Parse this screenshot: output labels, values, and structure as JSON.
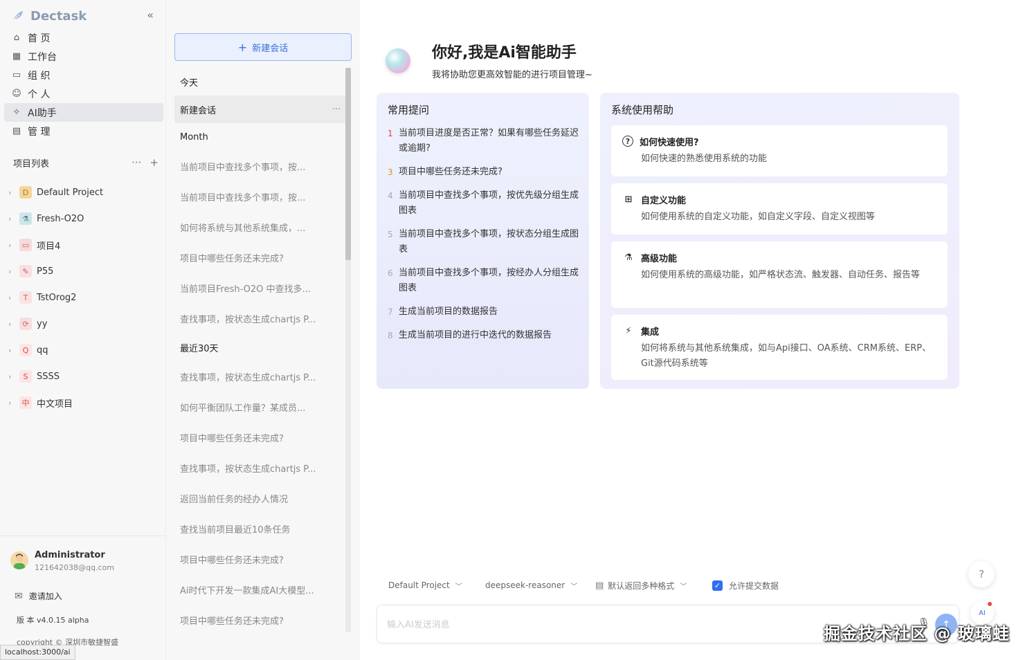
{
  "app": {
    "name": "Dectask"
  },
  "nav": [
    {
      "label": "首 页",
      "icon": "home-icon"
    },
    {
      "label": "工作台",
      "icon": "grid-icon"
    },
    {
      "label": "组 织",
      "icon": "folder-icon"
    },
    {
      "label": "个 人",
      "icon": "user-icon"
    },
    {
      "label": "AI助手",
      "icon": "ai-sparkle-icon",
      "active": true
    },
    {
      "label": "管 理",
      "icon": "manage-icon"
    }
  ],
  "projects_header": "项目列表",
  "projects": [
    {
      "label": "Default Project",
      "badge": "D",
      "color": "#f5d59a",
      "textColor": "#b07a2a"
    },
    {
      "label": "Fresh-O2O",
      "badge": "⚗",
      "color": "#cfe5e8",
      "textColor": "#4a7f88"
    },
    {
      "label": "项目4",
      "badge": "▭",
      "color": "#f7dada",
      "textColor": "#d05b5b"
    },
    {
      "label": "P55",
      "badge": "✎",
      "color": "#f8e0e0",
      "textColor": "#c56060"
    },
    {
      "label": "TstOrog2",
      "badge": "T",
      "color": "#fbe3e3",
      "textColor": "#d06060"
    },
    {
      "label": "yy",
      "badge": "⟳",
      "color": "#f6dede",
      "textColor": "#c86a6a"
    },
    {
      "label": "qq",
      "badge": "Q",
      "color": "#fde5e5",
      "textColor": "#d05050"
    },
    {
      "label": "SSSS",
      "badge": "S",
      "color": "#fde5e5",
      "textColor": "#d05050"
    },
    {
      "label": "中文项目",
      "badge": "中",
      "color": "#fde5e5",
      "textColor": "#d05050"
    }
  ],
  "user": {
    "name": "Administrator",
    "email": "121642038@qq.com",
    "invite": "邀请加入",
    "version": "版 本 v4.0.15 alpha",
    "copyright": "copyright © 深圳市敏捷智盛"
  },
  "status_url": "localhost:3000/ai",
  "conversations": {
    "new_chat": "新建会话",
    "groups": [
      {
        "title": "今天",
        "items": [
          {
            "label": "新建会话",
            "active": true
          }
        ]
      },
      {
        "title": "Month",
        "items": [
          {
            "label": "当前项目中查找多个事项，按..."
          },
          {
            "label": "当前项目中查找多个事项，按..."
          },
          {
            "label": "如何将系统与其他系统集成，..."
          },
          {
            "label": "项目中哪些任务还未完成?"
          },
          {
            "label": "当前项目Fresh-O2O 中查找多..."
          },
          {
            "label": "查找事项，按状态生成chartjs P..."
          }
        ]
      },
      {
        "title": "最近30天",
        "items": [
          {
            "label": "查找事项，按状态生成chartjs P..."
          },
          {
            "label": "如何平衡团队工作量？某成员..."
          },
          {
            "label": "项目中哪些任务还未完成?"
          },
          {
            "label": "查找事项，按状态生成chartjs P..."
          },
          {
            "label": "返回当前任务的经办人情况"
          },
          {
            "label": "查找当前项目最近10条任务"
          },
          {
            "label": "项目中哪些任务还未完成?"
          },
          {
            "label": "Ai时代下开发一款集成AI大模型..."
          },
          {
            "label": "项目中哪些任务还未完成?"
          }
        ]
      }
    ]
  },
  "hero": {
    "title": "你好,我是Ai智能助手",
    "subtitle": "我将协助您更高效智能的进行项目管理~"
  },
  "prompts": {
    "title": "常用提问",
    "items": [
      {
        "num": "1",
        "text": "当前项目进度是否正常？如果有哪些任务延迟或逾期?",
        "style": "r"
      },
      {
        "num": "3",
        "text": "项目中哪些任务还未完成?",
        "style": "o"
      },
      {
        "num": "4",
        "text": "当前项目中查找多个事项，按优先级分组生成图表",
        "style": ""
      },
      {
        "num": "5",
        "text": "当前项目中查找多个事项，按状态分组生成图表",
        "style": ""
      },
      {
        "num": "6",
        "text": "当前项目中查找多个事项，按经办人分组生成图表",
        "style": ""
      },
      {
        "num": "7",
        "text": "生成当前项目的数据报告",
        "style": ""
      },
      {
        "num": "8",
        "text": "生成当前项目的进行中迭代的数据报告",
        "style": ""
      }
    ]
  },
  "help": {
    "title": "系统使用帮助",
    "items": [
      {
        "title": "如何快速使用?",
        "desc": "如何快速的熟悉使用系统的功能",
        "icon": "question-circle-icon"
      },
      {
        "title": "自定义功能",
        "desc": "如何使用系统的自定义功能，如自定义字段、自定义视图等",
        "icon": "custom-grid-icon"
      },
      {
        "title": "高级功能",
        "desc": "如何使用系统的高级功能，如严格状态流、触发器、自动任务、报告等",
        "icon": "flask-icon"
      },
      {
        "title": "集成",
        "desc": "如何将系统与其他系统集成，如与Api接口、OA系统、CRM系统、ERP、Git源代码系统等",
        "icon": "plug-icon"
      }
    ]
  },
  "input": {
    "project": "Default Project",
    "model": "deepseek-reasoner",
    "format": "默认返回多种格式",
    "allow_submit": "允许提交数据",
    "placeholder": "输入AI发送消息"
  },
  "watermark": "掘金技术社区 @ 玻璃蛙"
}
